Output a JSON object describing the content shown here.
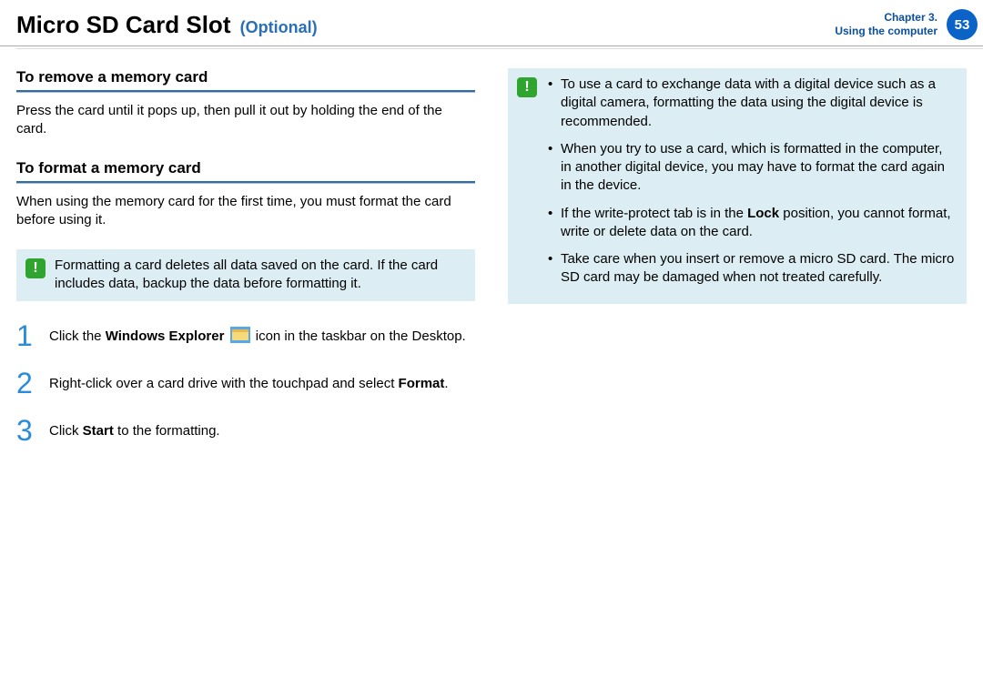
{
  "header": {
    "title_main": "Micro SD Card Slot",
    "title_sub": "(Optional)",
    "chapter_line1": "Chapter 3.",
    "chapter_line2": "Using the computer",
    "page_number": "53"
  },
  "left": {
    "section1_title": "To remove a memory card",
    "section1_body": "Press the card until it pops up, then pull it out by holding the end of the card.",
    "section2_title": "To format a memory card",
    "section2_body": "When using the memory card for the first time, you must format the card before using it.",
    "note": "Formatting a card deletes all data saved on the card. If the card includes data, backup the data before formatting it.",
    "steps": {
      "s1_a": "Click the ",
      "s1_bold": "Windows Explorer",
      "s1_b": " icon in the taskbar on the Desktop.",
      "s2_a": "Right-click over a card drive with the touchpad and select ",
      "s2_bold": "Format",
      "s2_b": ".",
      "s3_a": "Click ",
      "s3_bold": "Start",
      "s3_b": " to the formatting."
    }
  },
  "right": {
    "bullets": {
      "b1": "To use a card to exchange data with a digital device such as a digital camera, formatting the data using the digital device is recommended.",
      "b2": "When you try to use a card, which is formatted in the computer, in another digital device, you may have to format the card again in the device.",
      "b3_a": "If the write-protect tab is in the ",
      "b3_bold": "Lock",
      "b3_b": " position, you cannot format, write or delete data on the card.",
      "b4": "Take care when you insert or remove a micro SD card. The micro SD card may be damaged when not treated carefully."
    }
  },
  "icons": {
    "alert": "!",
    "step1": "1",
    "step2": "2",
    "step3": "3"
  }
}
